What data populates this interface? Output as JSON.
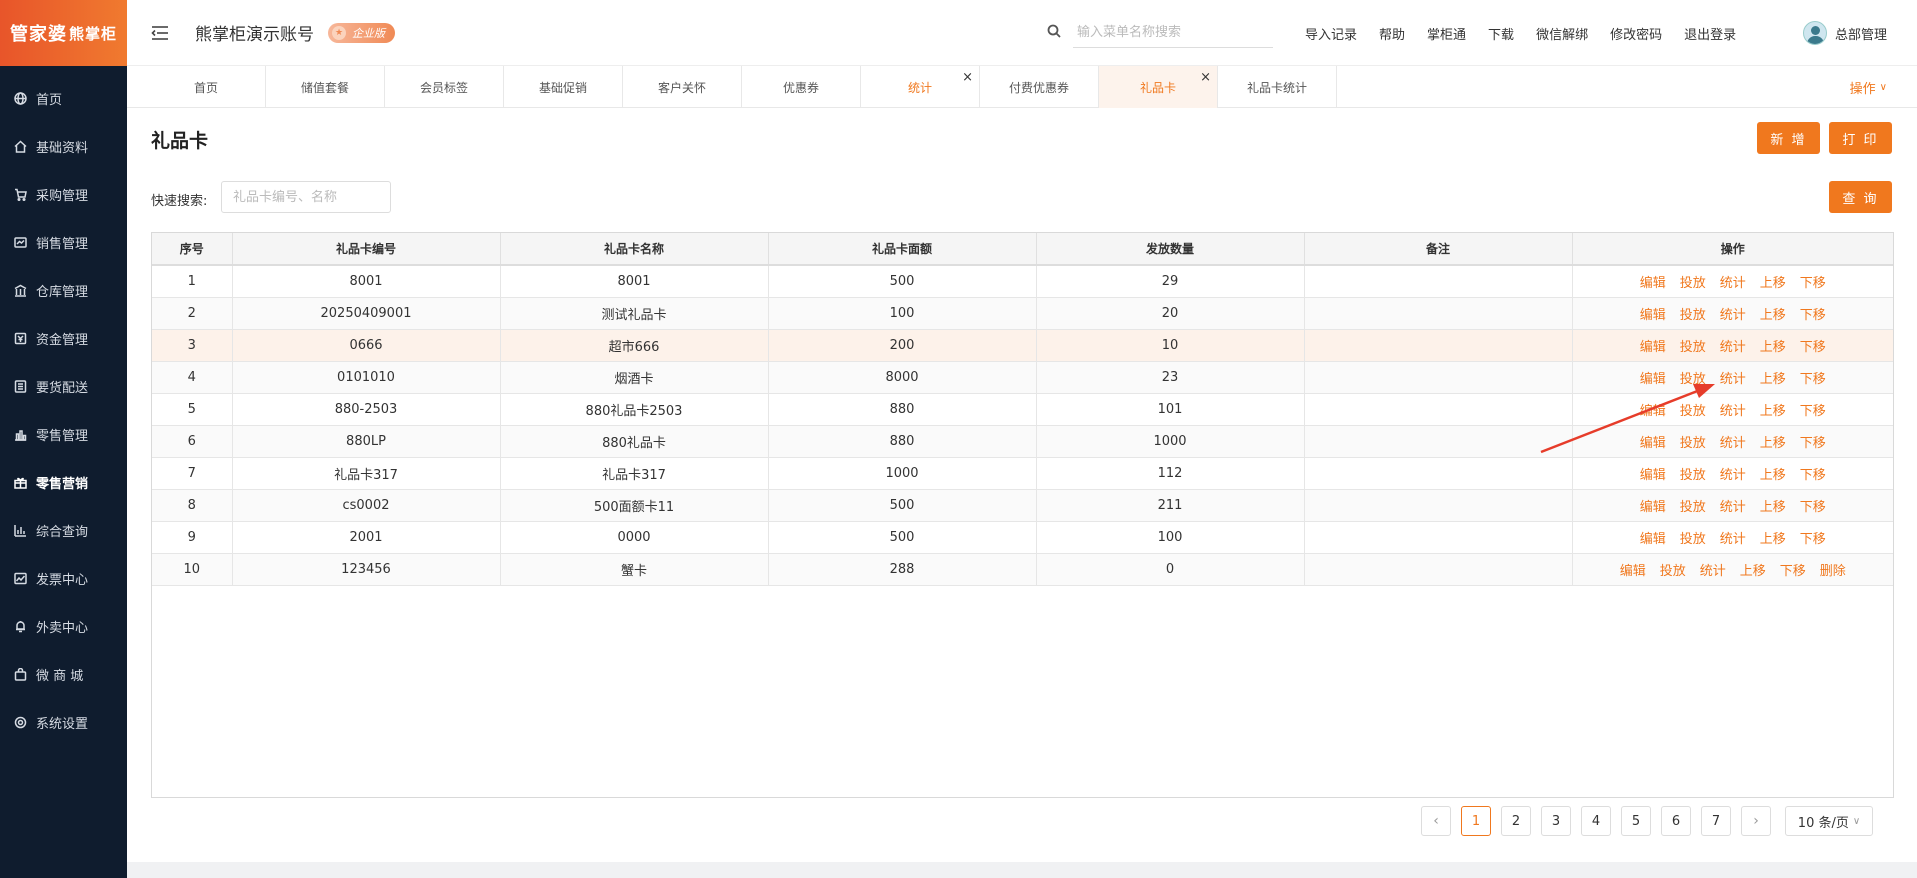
{
  "app": {
    "logo_main": "管家婆",
    "logo_sub": "熊掌柜",
    "account_title": "熊掌柜演示账号",
    "edition_badge": "企业版",
    "user_name": "总部管理"
  },
  "sidebar": {
    "items": [
      {
        "label": "首页",
        "icon": "globe-icon"
      },
      {
        "label": "基础资料",
        "icon": "home-icon"
      },
      {
        "label": "采购管理",
        "icon": "cart-icon"
      },
      {
        "label": "销售管理",
        "icon": "sales-icon"
      },
      {
        "label": "仓库管理",
        "icon": "warehouse-icon"
      },
      {
        "label": "资金管理",
        "icon": "money-icon"
      },
      {
        "label": "要货配送",
        "icon": "list-icon"
      },
      {
        "label": "零售管理",
        "icon": "bar-chart-icon"
      },
      {
        "label": "零售营销",
        "icon": "gift-icon"
      },
      {
        "label": "综合查询",
        "icon": "chart-icon"
      },
      {
        "label": "发票中心",
        "icon": "trend-icon"
      },
      {
        "label": "外卖中心",
        "icon": "bell-icon"
      },
      {
        "label": "微 商 城",
        "icon": "bag-icon"
      },
      {
        "label": "系统设置",
        "icon": "gear-icon"
      }
    ],
    "active_index": 8
  },
  "header": {
    "search_placeholder": "输入菜单名称搜索",
    "links": [
      "导入记录",
      "帮助",
      "掌柜通",
      "下载",
      "微信解绑",
      "修改密码",
      "退出登录"
    ]
  },
  "tabs": {
    "items": [
      "首页",
      "储值套餐",
      "会员标签",
      "基础促销",
      "客户关怀",
      "优惠券",
      "统计",
      "付费优惠券",
      "礼品卡",
      "礼品卡统计"
    ],
    "action_label": "操作"
  },
  "main": {
    "title": "礼品卡",
    "add_label": "新 增",
    "print_label": "打 印",
    "query_label": "查 询",
    "quick_search_label": "快速搜索:",
    "quick_search_placeholder": "礼品卡编号、名称"
  },
  "table": {
    "columns": [
      "序号",
      "礼品卡编号",
      "礼品卡名称",
      "礼品卡面额",
      "发放数量",
      "备注",
      "操作"
    ],
    "rows": [
      [
        "1",
        "8001",
        "8001",
        "500",
        "29",
        ""
      ],
      [
        "2",
        "20250409001",
        "测试礼品卡",
        "100",
        "20",
        ""
      ],
      [
        "3",
        "0666",
        "超市666",
        "200",
        "10",
        ""
      ],
      [
        "4",
        "0101010",
        "烟酒卡",
        "8000",
        "23",
        ""
      ],
      [
        "5",
        "880-2503",
        "880礼品卡2503",
        "880",
        "101",
        ""
      ],
      [
        "6",
        "880LP",
        "880礼品卡",
        "880",
        "1000",
        ""
      ],
      [
        "7",
        "礼品卡317",
        "礼品卡317",
        "1000",
        "112",
        ""
      ],
      [
        "8",
        "cs0002",
        "500面额卡11",
        "500",
        "211",
        ""
      ],
      [
        "9",
        "2001",
        "0000",
        "500",
        "100",
        ""
      ],
      [
        "10",
        "123456",
        "蟹卡",
        "288",
        "0",
        ""
      ]
    ],
    "actions": [
      "编辑",
      "投放",
      "统计",
      "上移",
      "下移"
    ],
    "extra_action_last_row": "删除"
  },
  "pagination": {
    "pages": [
      "1",
      "2",
      "3",
      "4",
      "5",
      "6",
      "7"
    ],
    "current": "1",
    "prev": "‹",
    "next": "›",
    "page_size": "10 条/页"
  },
  "colors": {
    "accent": "#f0781e",
    "sidebar_bg": "#0f1c2e",
    "highlight_row": "#fdf2ea"
  }
}
